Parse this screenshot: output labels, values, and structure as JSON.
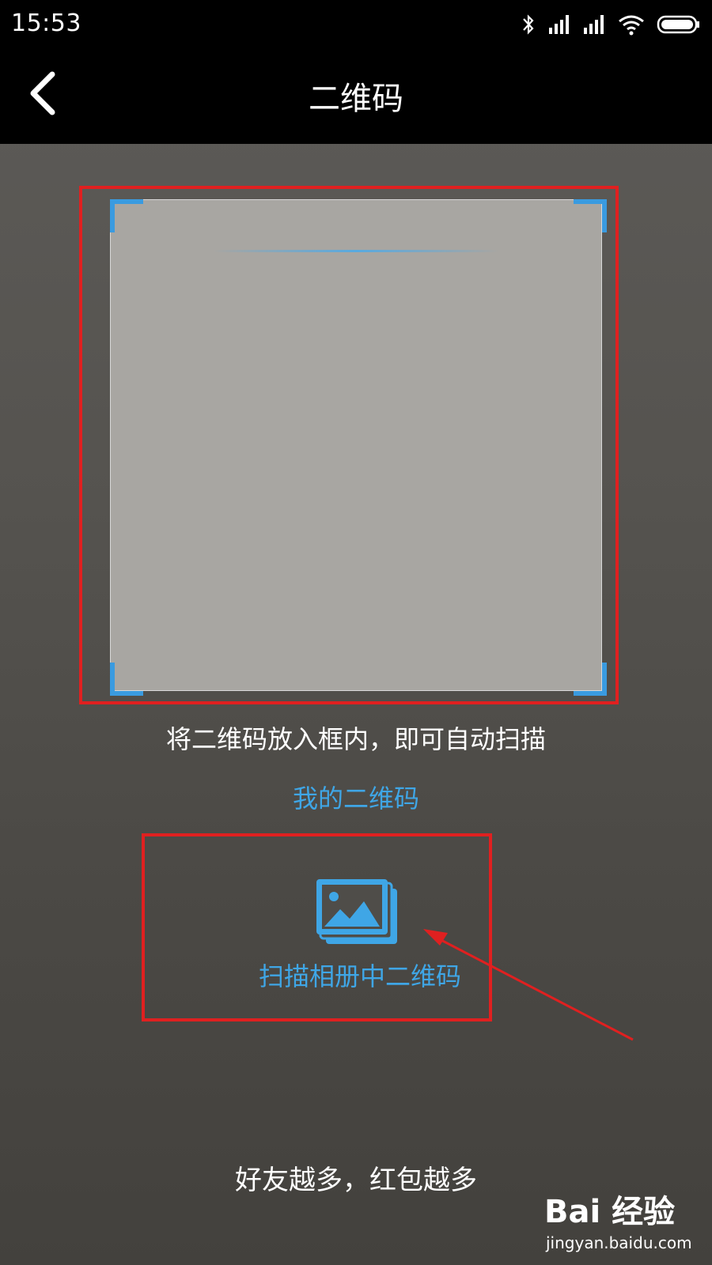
{
  "status_bar": {
    "time": "15:53",
    "icons": [
      "bluetooth-icon",
      "signal-icon",
      "signal-icon",
      "wifi-icon",
      "battery-icon"
    ]
  },
  "header": {
    "title": "二维码",
    "back_icon": "chevron-left-icon"
  },
  "scanner": {
    "frame_color": "#3a9be0",
    "hint": "将二维码放入框内，即可自动扫描",
    "my_qr_link": "我的二维码"
  },
  "album": {
    "icon": "gallery-icon",
    "label": "扫描相册中二维码"
  },
  "footer": {
    "text": "好友越多，红包越多"
  },
  "watermark": {
    "brand": "Bai 经验",
    "url": "jingyan.baidu.com"
  },
  "colors": {
    "accent": "#3fa6e6",
    "annotation": "#e02020"
  }
}
